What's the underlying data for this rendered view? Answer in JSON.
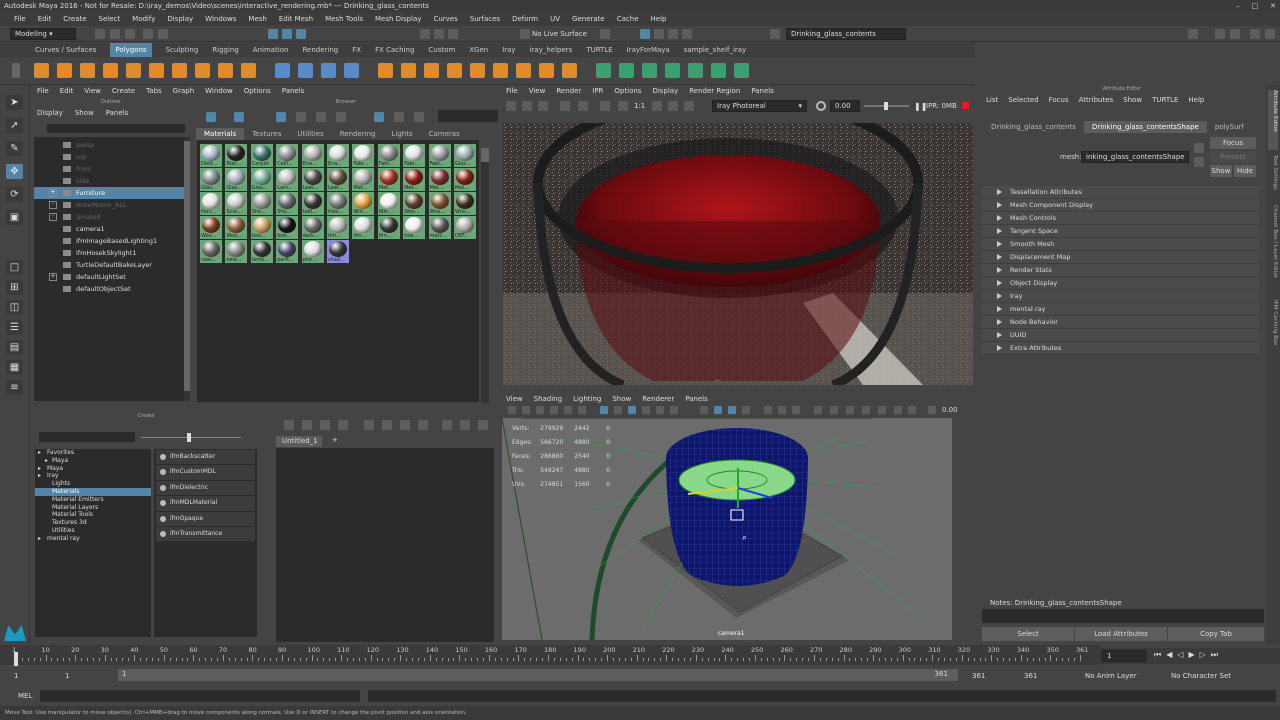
{
  "window": {
    "title": "Autodesk Maya 2016 - Not for Resale: D:\\iray_demos\\Video\\scenes\\interactive_rendering.mb*  ---  Drinking_glass_contents"
  },
  "menubar": [
    "File",
    "Edit",
    "Create",
    "Select",
    "Modify",
    "Display",
    "Windows",
    "Mesh",
    "Edit Mesh",
    "Mesh Tools",
    "Mesh Display",
    "Curves",
    "Surfaces",
    "Deform",
    "UV",
    "Generate",
    "Cache",
    "Help"
  ],
  "status": {
    "mode": "Modeling",
    "live_surface": "No Live Surface",
    "selected_object": "Drinking_glass_contents"
  },
  "shelf_tabs": [
    "Curves / Surfaces",
    "Polygons",
    "Sculpting",
    "Rigging",
    "Animation",
    "Rendering",
    "FX",
    "FX Caching",
    "Custom",
    "XGen",
    "Iray",
    "iray_helpers",
    "TURTLE",
    "IrayForMaya",
    "sample_shelf_iray"
  ],
  "shelf_active": "Polygons",
  "outliner": {
    "top_menu": [
      "File",
      "Edit",
      "View",
      "Create",
      "Tabs",
      "Graph",
      "Window",
      "Options",
      "Panels"
    ],
    "header": "Outliner",
    "menu": [
      "Display",
      "Show",
      "Panels"
    ],
    "items": [
      {
        "label": "persp",
        "gray": true,
        "plus": false
      },
      {
        "label": "top",
        "gray": true,
        "plus": false
      },
      {
        "label": "front",
        "gray": true,
        "plus": false
      },
      {
        "label": "side",
        "gray": true,
        "plus": false
      },
      {
        "label": "Furniture",
        "gray": false,
        "plus": true,
        "selected": true
      },
      {
        "label": "HotelRoom_ALL",
        "gray": true,
        "plus": true
      },
      {
        "label": "Unused",
        "gray": true,
        "plus": true
      },
      {
        "label": "camera1",
        "gray": false,
        "plus": false
      },
      {
        "label": "ifmImageBasedLighting1",
        "gray": false,
        "plus": false
      },
      {
        "label": "ifmHosekSkylight1",
        "gray": false,
        "plus": false
      },
      {
        "label": "TurtleDefaultBakeLayer",
        "gray": false,
        "plus": false
      },
      {
        "label": "defaultLightSet",
        "gray": false,
        "plus": true
      },
      {
        "label": "defaultObjectSet",
        "gray": false,
        "plus": false
      }
    ]
  },
  "browser": {
    "header": "Browser",
    "tabs": [
      "Materials",
      "Textures",
      "Utilities",
      "Rendering",
      "Lights",
      "Cameras"
    ],
    "swatches": [
      [
        "Dielt...",
        "Blac...",
        "Carpet",
        "Ceili...",
        "Ena...",
        "Ena...",
        "Fabr...",
        "Fabr...",
        "Fabr...",
        "Fabr...",
        "Glas..."
      ],
      [
        "Glas...",
        "Glas...",
        "Glas...",
        "Lam...",
        "Leat...",
        "Leat...",
        "Met...",
        "Met...",
        "Met...",
        "Met...",
        "Met..."
      ],
      [
        "Porc...",
        "Scre...",
        "Sho...",
        "Sho...",
        "tabl...",
        "tiles...",
        "Win...",
        "Win...",
        "Woo...",
        "Woo...",
        "Woo..."
      ],
      [
        "Woo...",
        "Woo...",
        "boo...",
        "boo...",
        "dark...",
        "ifm...",
        "ifm...",
        "ifm...",
        "tow...",
        "matt...",
        "DEF..."
      ],
      [
        "roas...",
        "new...",
        "lamb...",
        "parfi...",
        "pho...",
        "shad..."
      ]
    ],
    "swatch_colors": [
      [
        "#a8b8c8",
        "#222",
        "#3b6e6a",
        "#8d8d8d",
        "#b0b0b0",
        "#d8d8d8",
        "#e8e8e8",
        "#888",
        "#e0e0e0",
        "#999",
        "#9aa"
      ],
      [
        "#7a8a8a",
        "#aab",
        "#7a9",
        "#bbb",
        "#444",
        "#5a4a3a",
        "#b0b0b0",
        "#a03020",
        "#8a1a10",
        "#7a2a2a",
        "#802010"
      ],
      [
        "#e0e0e0",
        "#ccc",
        "#999",
        "#666",
        "#333",
        "#777",
        "#e0a040",
        "#f0f0f0",
        "#5a3a2a",
        "#7a5030",
        "#3a2a1a"
      ],
      [
        "#7a3a1a",
        "#8a5a3a",
        "#c8a060",
        "#111",
        "#666",
        "#bbb",
        "#ddd",
        "#333",
        "#eee",
        "#555",
        "#aaa"
      ],
      [
        "#666",
        "#888",
        "#333",
        "#446",
        "#ddd",
        "#333"
      ]
    ]
  },
  "render_view": {
    "menu": [
      "File",
      "View",
      "Render",
      "IPR",
      "Options",
      "Display",
      "Render Region",
      "Panels"
    ],
    "renderer": "Iray Photoreal",
    "exposure": "0.00",
    "ratio": "1:1",
    "ipr": "IPR: 0MB"
  },
  "viewport": {
    "menu": [
      "View",
      "Shading",
      "Lighting",
      "Show",
      "Renderer",
      "Panels"
    ],
    "value": "0.00",
    "camera": "camera1",
    "stats": [
      {
        "label": "Verts:",
        "a": "279929",
        "b": "2442",
        "c": "0"
      },
      {
        "label": "Edges:",
        "a": "566720",
        "b": "4880",
        "c": "0"
      },
      {
        "label": "Faces:",
        "a": "286860",
        "b": "2540",
        "c": "0"
      },
      {
        "label": "Tris:",
        "a": "549247",
        "b": "4880",
        "c": "0"
      },
      {
        "label": "UVs:",
        "a": "274851",
        "b": "1560",
        "c": "0"
      }
    ]
  },
  "attribute_editor": {
    "header": "Attribute Editor",
    "menu": [
      "List",
      "Selected",
      "Focus",
      "Attributes",
      "Show",
      "TURTLE",
      "Help"
    ],
    "tabs": [
      "Drinking_glass_contents",
      "Drinking_glass_contentsShape",
      "polySurf"
    ],
    "mesh_label": "mesh:",
    "mesh_value": "inking_glass_contentsShape",
    "focus": "Focus",
    "presets": "Presets",
    "show": "Show",
    "hide": "Hide",
    "sections": [
      "Tessellation Attributes",
      "Mesh Component Display",
      "Mesh Controls",
      "Tangent Space",
      "Smooth Mesh",
      "Displacement Map",
      "Render Stats",
      "Object Display",
      "Iray",
      "mental ray",
      "Node Behavior",
      "UUID",
      "Extra Attributes"
    ],
    "notes": "Notes:  Drinking_glass_contentsShape",
    "buttons": [
      "Select",
      "Load Attributes",
      "Copy Tab"
    ],
    "side_tabs": [
      "Attribute Editor",
      "Tool Settings",
      "Channel Box / Layer Editor",
      "IFM Caching Box"
    ]
  },
  "create_panel": {
    "header": "Create",
    "tree": [
      {
        "label": "Favorites",
        "indent": 0,
        "arrow": true
      },
      {
        "label": "Maya",
        "indent": 1,
        "arrow": true
      },
      {
        "label": "Maya",
        "indent": 0,
        "arrow": true
      },
      {
        "label": "Iray",
        "indent": 0,
        "arrow": true
      },
      {
        "label": "Lights",
        "indent": 1,
        "arrow": false
      },
      {
        "label": "Materials",
        "indent": 1,
        "arrow": false,
        "selected": true
      },
      {
        "label": "Material Emitters",
        "indent": 1,
        "arrow": false
      },
      {
        "label": "Material Layers",
        "indent": 1,
        "arrow": false
      },
      {
        "label": "Material Tools",
        "indent": 1,
        "arrow": false
      },
      {
        "label": "Textures 3d",
        "indent": 1,
        "arrow": false
      },
      {
        "label": "Utilities",
        "indent": 1,
        "arrow": false
      },
      {
        "label": "mental ray",
        "indent": 0,
        "arrow": true
      }
    ],
    "materials": [
      "ifmBackscatter",
      "ifmCustomMDL",
      "ifmDielectric",
      "ifmMDLMaterial",
      "ifmOpaque",
      "ifmTransmittance"
    ]
  },
  "hypershade_tab": "Untitled_1",
  "timeline": {
    "ticks": [
      "1",
      "10",
      "20",
      "30",
      "40",
      "50",
      "60",
      "70",
      "80",
      "90",
      "100",
      "110",
      "120",
      "130",
      "140",
      "150",
      "160",
      "170",
      "180",
      "190",
      "200",
      "210",
      "220",
      "230",
      "240",
      "250",
      "260",
      "270",
      "280",
      "290",
      "300",
      "310",
      "320",
      "330",
      "340",
      "350",
      "361"
    ],
    "current_frame": "1",
    "start": "1",
    "start2": "1",
    "range_start": "1",
    "range_end": "361",
    "end": "361",
    "end2": "361",
    "anim_layer": "No Anim Layer",
    "char_set": "No Character Set"
  },
  "command_line": {
    "label": "MEL"
  },
  "help_line": "Move Tool: Use manipulator to move object(s). Ctrl+MMB+drag to move components along normals. Use D or INSERT to change the pivot position and axis orientation."
}
